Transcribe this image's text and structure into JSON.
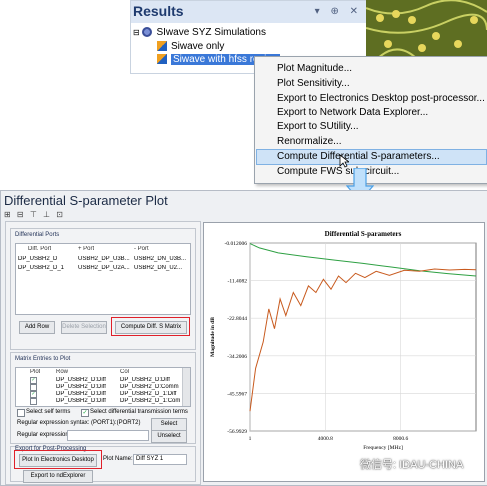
{
  "results": {
    "title": "Results",
    "controls": "▾ ⊕ ✕",
    "tree": [
      "SIwave SYZ Simulations",
      "Siwave only",
      "Siwave with hfss region"
    ]
  },
  "context_menu": {
    "items": [
      "Plot Magnitude...",
      "Plot Sensitivity...",
      "Export to Electronics Desktop post-processor...",
      "Export to Network Data Explorer...",
      "Export to SUtility...",
      "Renormalize...",
      "Compute Differential S-parameters...",
      "Compute FWS sub-circuit..."
    ],
    "highlighted_index": 6
  },
  "dialog": {
    "title": "Differential S-parameter Plot",
    "toolbar": "⊞ ⊟ ⊤ ⊥ ⊡",
    "diff_ports": {
      "label": "Differential Ports",
      "headers": [
        "Diff. Port",
        "+ Port",
        "- Port"
      ],
      "rows": [
        [
          "DP_USBH2_D",
          "USBH2_DP_U3B...",
          "USBH2_DN_U3B..."
        ],
        [
          "DP_USBH2_D_1",
          "USBH2_DP_U2A...",
          "USBH2_DN_U2..."
        ]
      ],
      "add_row": "Add Row",
      "delete_selection": "Delete Selection",
      "compute": "Compute Diff. S Matrix"
    },
    "matrix": {
      "label": "Matrix Entries to Plot",
      "headers": [
        "Plot",
        "Row",
        "Col"
      ],
      "rows": [
        {
          "checked": true,
          "row": "DP_USBH2_D:Diff",
          "col": "DP_USBH2_D:Diff"
        },
        {
          "checked": false,
          "row": "DP_USBH2_D:Diff",
          "col": "DP_USBH2_D:Comm"
        },
        {
          "checked": true,
          "row": "DP_USBH2_D:Diff",
          "col": "DP_USBH2_D_1:Diff"
        },
        {
          "checked": false,
          "row": "DP_USBH2_D:Diff",
          "col": "DP_USBH2_D_1:Comm"
        }
      ],
      "self_terms": "Select self terms",
      "transmission_terms": "Select differential transmission terms",
      "regex_syntax_label": "Regular expression syntax: (PORT1):(PORT2)",
      "select": "Select",
      "regex_label": "Regular expression:",
      "unselect": "Unselect"
    },
    "export": {
      "label": "Export for Post-Processing",
      "plot_electronics": "Plot In Electronics Desktop",
      "plot_name_label": "Plot Name:",
      "plot_name_value": "Diff SYZ 1",
      "export_nd": "Export to ndExplorer"
    }
  },
  "chart_data": {
    "type": "line",
    "title": "Differential S-parameters",
    "ylabel": "Magnitude in dB",
    "xlabel": "Frequency [MHz]",
    "yticks": [
      "-0.012006",
      "-11.4082",
      "-22.8044",
      "-34.2006",
      "-45.5967",
      "-56.9929"
    ],
    "xticks": [
      "1",
      "4000.8",
      "8000.6"
    ],
    "ylim": [
      -56.9929,
      -0.012006
    ],
    "xlim": [
      1,
      12000
    ],
    "series": [
      {
        "color": "#2ea043",
        "x": [
          1,
          500,
          1500,
          3000,
          4500,
          6000,
          7500,
          9000,
          10500,
          12000
        ],
        "y": [
          -0.2,
          -1.5,
          -3.0,
          -4.2,
          -5.2,
          -6.2,
          -7.3,
          -8.4,
          -9.3,
          -10.0
        ]
      },
      {
        "color": "#c85a1e",
        "x": [
          1,
          300,
          700,
          1000,
          1300,
          1600,
          1900,
          2300,
          2700,
          3100,
          3500,
          3900,
          4300,
          4700,
          5100,
          5600,
          6100,
          6700,
          7400,
          8200,
          9000,
          9800,
          10600,
          11400,
          12000
        ],
        "y": [
          -51,
          -38,
          -30,
          -20,
          -26,
          -17,
          -22,
          -15,
          -19,
          -13,
          -15,
          -11,
          -14,
          -10,
          -12,
          -9.2,
          -10.5,
          -8.6,
          -9.8,
          -8.3,
          -8.6,
          -7.9,
          -8.2,
          -8.0,
          -8.1
        ]
      }
    ]
  },
  "watermark": "微信号: IDAU-CHINA"
}
